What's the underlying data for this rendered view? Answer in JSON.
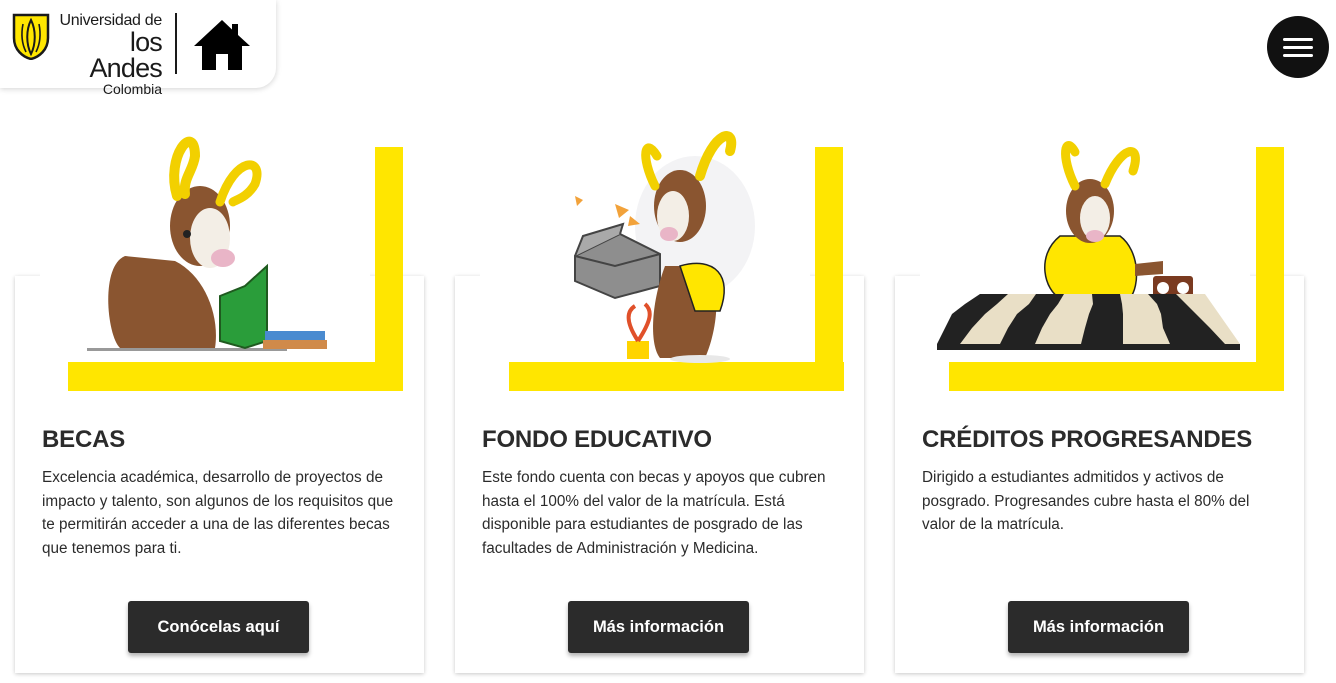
{
  "header": {
    "logo": {
      "line1": "Universidad de",
      "line2": "los Andes",
      "line3": "Colombia"
    },
    "home_icon": "home-icon",
    "menu_icon": "hamburger-menu-icon"
  },
  "colors": {
    "accent_yellow": "#ffe600",
    "button_dark": "#2b2b2b",
    "text": "#2b2b2b"
  },
  "cards": [
    {
      "title": "BECAS",
      "description": "Excelencia académica, desarrollo de proyectos de impacto y talento, son algunos de los requisitos que te permitirán acceder a una de las diferentes becas que tenemos para ti.",
      "button_label": "Conócelas aquí",
      "illustration": "goat-reading-book-illustration"
    },
    {
      "title": "FONDO EDUCATIVO",
      "description": "Este fondo cuenta con becas y apoyos que cubren hasta el 100% del valor de la matrícula. Está disponible para estudiantes de posgrado de las facultades de Administración y Medicina.",
      "button_label": "Más información",
      "illustration": "goat-holding-box-illustration"
    },
    {
      "title": "CRÉDITOS PROGRESANDES",
      "description": "Dirigido a estudiantes admitidos y activos de posgrado. Progresandes cubre hasta el 80% del valor de la matrícula.",
      "button_label": "Más información",
      "illustration": "goat-playing-chess-illustration"
    }
  ]
}
